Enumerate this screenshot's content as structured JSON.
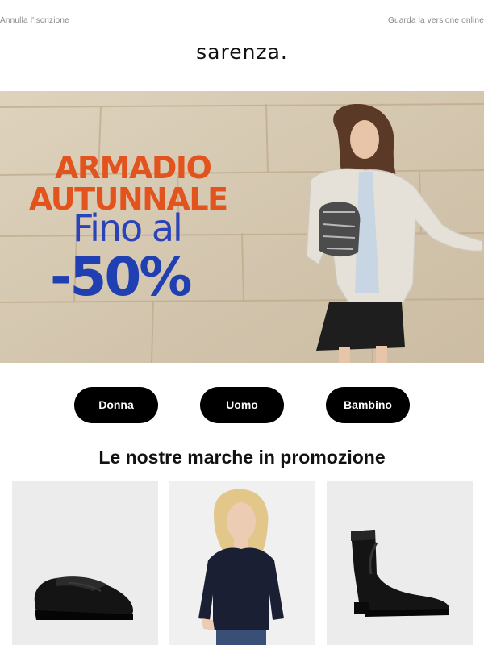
{
  "header": {
    "unsubscribe_label": "Annulla l'iscrizione",
    "view_online_label": "Guarda la versione online",
    "logo_text": "sarenza."
  },
  "hero": {
    "line1": "ARMADIO",
    "line2": "AUTUNNALE",
    "line3": "Fino al",
    "line4": "-50%",
    "colors": {
      "headline": "#e2531d",
      "discount": "#1f3fb2"
    }
  },
  "categories": [
    {
      "label": "Donna"
    },
    {
      "label": "Uomo"
    },
    {
      "label": "Bambino"
    }
  ],
  "brands_section": {
    "title": "Le nostre marche in promozione",
    "products": [
      {
        "icon": "loafer-shoe-icon"
      },
      {
        "icon": "sweater-model-icon"
      },
      {
        "icon": "ankle-boot-icon"
      }
    ]
  }
}
